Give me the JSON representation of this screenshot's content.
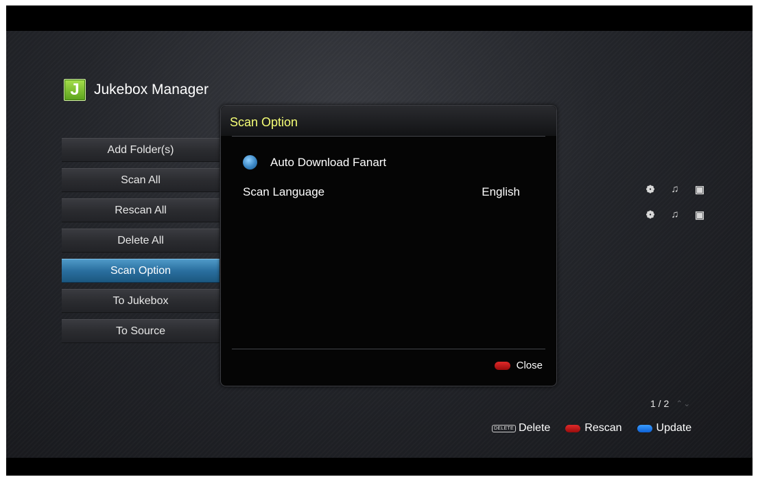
{
  "app": {
    "logo_letter": "J",
    "title": "Jukebox Manager"
  },
  "menu": {
    "items": [
      {
        "label": "Add Folder(s)"
      },
      {
        "label": "Scan All"
      },
      {
        "label": "Rescan All"
      },
      {
        "label": "Delete All"
      },
      {
        "label": "Scan Option",
        "active": true
      },
      {
        "label": "To Jukebox"
      },
      {
        "label": "To Source"
      }
    ]
  },
  "media_rows": [
    {
      "icons": [
        "movie-reel-icon",
        "music-note-icon",
        "camera-icon"
      ]
    },
    {
      "icons": [
        "movie-reel-icon",
        "music-note-icon",
        "camera-icon"
      ]
    }
  ],
  "dialog": {
    "title": "Scan Option",
    "auto_download": {
      "label": "Auto Download Fanart",
      "checked": true
    },
    "scan_language": {
      "label": "Scan Language",
      "value": "English"
    },
    "close_label": "Close"
  },
  "pager": {
    "text": "1 / 2"
  },
  "footer": {
    "delete_key": "DELETE",
    "delete_label": "Delete",
    "rescan_label": "Rescan",
    "update_label": "Update"
  },
  "colors": {
    "title_yellow": "#f6ff76",
    "active_blue": "#2a6f9f",
    "red_key": "#c81818",
    "blue_key": "#1a78f0"
  }
}
